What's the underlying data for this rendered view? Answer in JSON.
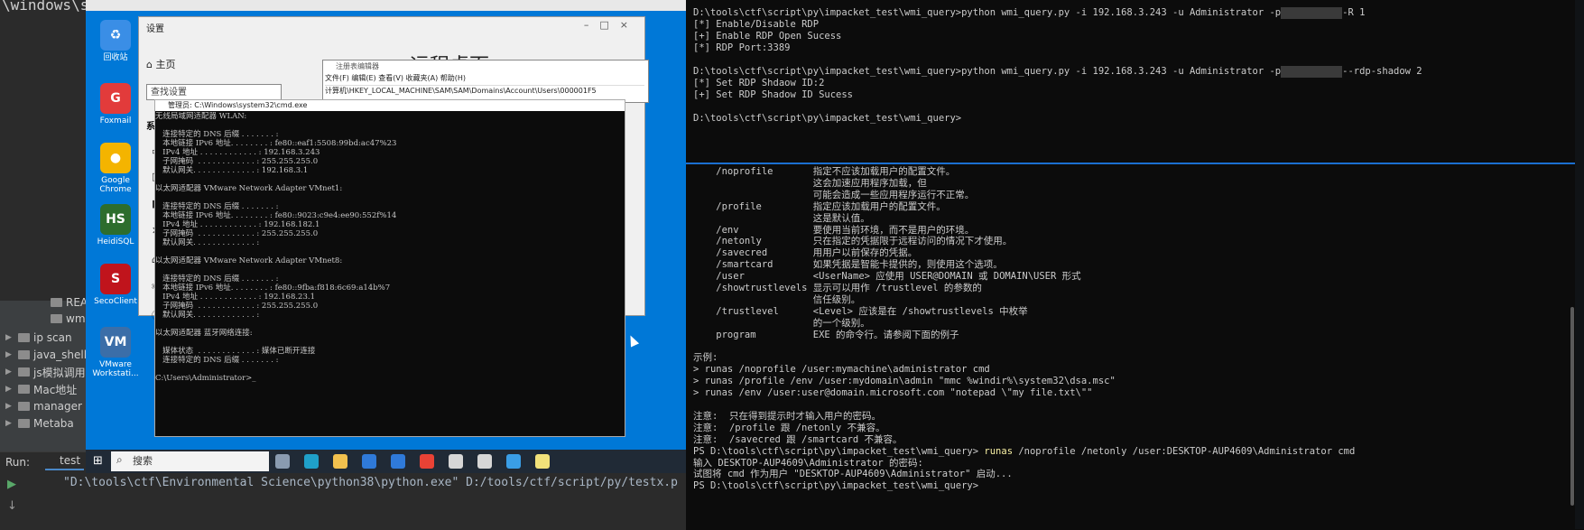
{
  "ide": {
    "top_text": "\\windows\\sys",
    "tree": [
      {
        "label": "REA",
        "icon": "file-icon"
      },
      {
        "label": "wm",
        "icon": "python-file-icon"
      },
      {
        "label": "ip scan",
        "icon": "folder-icon"
      },
      {
        "label": "java_shell",
        "icon": "folder-icon"
      },
      {
        "label": "js模拟调用",
        "icon": "folder-icon"
      },
      {
        "label": "Mac地址",
        "icon": "folder-icon"
      },
      {
        "label": "manager",
        "icon": "folder-icon"
      },
      {
        "label": "Metaba",
        "icon": "folder-icon"
      }
    ],
    "run_label": "Run:",
    "run_tab": "test",
    "run_cmd": "\"D:\\tools\\ctf\\Environmental Science\\python38\\python.exe\" D:/tools/ctf/script/py/testx.p"
  },
  "rdp": {
    "desktop_icons": [
      {
        "label": "回收站",
        "color": "#3a8ee6",
        "glyph": "♻"
      },
      {
        "label": "Foxmail",
        "color": "#e23b3b",
        "glyph": "G"
      },
      {
        "label": "Google Chrome",
        "color": "#f4b400",
        "glyph": "●"
      },
      {
        "label": "HeidiSQL",
        "color": "#2d6d2d",
        "glyph": "HS"
      },
      {
        "label": "SecoClient",
        "color": "#c0141c",
        "glyph": "S"
      },
      {
        "label": "VMware Workstati...",
        "color": "#3b6ea8",
        "glyph": "VM"
      }
    ],
    "settings": {
      "title": "设置",
      "home": "主页",
      "search_placeholder": "查找设置",
      "system": "系统",
      "remote_heading": "远程桌面"
    },
    "regedit": {
      "title": "注册表编辑器",
      "menu": "文件(F)  编辑(E)  查看(V)  收藏夹(A)  帮助(H)",
      "path": "计算机\\HKEY_LOCAL_MACHINE\\SAM\\SAM\\Domains\\Account\\Users\\000001F5"
    },
    "cmd": {
      "title": "管理员: C:\\Windows\\system32\\cmd.exe",
      "lines": [
        "无线局域网适配器 WLAN:",
        "",
        "   连接特定的 DNS 后缀 . . . . . . . :",
        "   本地链接 IPv6 地址. . . . . . . . : fe80::eaf1:5508:99bd:ac47%23",
        "   IPv4 地址 . . . . . . . . . . . . : 192.168.3.243",
        "   子网掩码  . . . . . . . . . . . . : 255.255.255.0",
        "   默认网关. . . . . . . . . . . . . : 192.168.3.1",
        "",
        "以太网适配器 VMware Network Adapter VMnet1:",
        "",
        "   连接特定的 DNS 后缀 . . . . . . . :",
        "   本地链接 IPv6 地址. . . . . . . . : fe80::9023:c9e4:ee90:552f%14",
        "   IPv4 地址 . . . . . . . . . . . . : 192.168.182.1",
        "   子网掩码  . . . . . . . . . . . . : 255.255.255.0",
        "   默认网关. . . . . . . . . . . . . :",
        "",
        "以太网适配器 VMware Network Adapter VMnet8:",
        "",
        "   连接特定的 DNS 后缀 . . . . . . . :",
        "   本地链接 IPv6 地址. . . . . . . . : fe80::9fba:f818:6c69:a14b%7",
        "   IPv4 地址 . . . . . . . . . . . . : 192.168.23.1",
        "   子网掩码  . . . . . . . . . . . . : 255.255.255.0",
        "   默认网关. . . . . . . . . . . . . :",
        "",
        "以太网适配器 蓝牙网络连接:",
        "",
        "   媒体状态  . . . . . . . . . . . . : 媒体已断开连接",
        "   连接特定的 DNS 后缀 . . . . . . . :",
        "",
        "C:\\Users\\Administrator>_"
      ]
    },
    "taskbar": {
      "search": "搜索",
      "apps": [
        {
          "name": "task-view-icon",
          "color": "#8a9bb0"
        },
        {
          "name": "edge-icon",
          "color": "#1fa0c9"
        },
        {
          "name": "explorer-icon",
          "color": "#f2c14e"
        },
        {
          "name": "store-icon",
          "color": "#2f7ad9"
        },
        {
          "name": "mail-icon",
          "color": "#2f7ad9"
        },
        {
          "name": "chrome-icon",
          "color": "#e94235"
        },
        {
          "name": "settings-icon",
          "color": "#d6d6d6"
        },
        {
          "name": "cmd-icon",
          "color": "#d6d6d6"
        },
        {
          "name": "vscode-icon",
          "color": "#3a9ee6"
        },
        {
          "name": "notepad-icon",
          "color": "#f2e27a"
        }
      ]
    }
  },
  "terminal_top": [
    {
      "pre": "D:\\tools\\ctf\\script\\py\\impacket_test\\wmi_query>python wmi_query.py -i 192.168.3.243 -u Administrator -p",
      "redacted": true,
      "post": "-R 1"
    },
    {
      "pre": "[*] Enable/Disable RDP"
    },
    {
      "pre": "[+] Enable RDP Open Sucess"
    },
    {
      "pre": "[*] RDP Port:3389"
    },
    {
      "pre": ""
    },
    {
      "pre": "D:\\tools\\ctf\\script\\py\\impacket_test\\wmi_query>python wmi_query.py -i 192.168.3.243 -u Administrator -p",
      "redacted": true,
      "post": "--rdp-shadow 2"
    },
    {
      "pre": "[*] Set RDP Shdaow ID:2"
    },
    {
      "pre": "[+] Set RDP Shadow ID Sucess"
    },
    {
      "pre": ""
    },
    {
      "pre": "D:\\tools\\ctf\\script\\py\\impacket_test\\wmi_query>"
    }
  ],
  "terminal_bottom": [
    {
      "text": "    /noprofile       指定不应该加载用户的配置文件。"
    },
    {
      "text": "                     这会加速应用程序加载，但"
    },
    {
      "text": "                     可能会造成一些应用程序运行不正常。"
    },
    {
      "text": "    /profile         指定应该加载用户的配置文件。"
    },
    {
      "text": "                     这是默认值。"
    },
    {
      "text": "    /env             要使用当前环境，而不是用户的环境。"
    },
    {
      "text": "    /netonly         只在指定的凭据限于远程访问的情况下才使用。"
    },
    {
      "text": "    /savecred        用用户以前保存的凭据。"
    },
    {
      "text": "    /smartcard       如果凭据是智能卡提供的，则使用这个选项。"
    },
    {
      "text": "    /user            <UserName> 应使用 USER@DOMAIN 或 DOMAIN\\USER 形式"
    },
    {
      "text": "    /showtrustlevels 显示可以用作 /trustlevel 的参数的"
    },
    {
      "text": "                     信任级别。"
    },
    {
      "text": "    /trustlevel      <Level> 应该是在 /showtrustlevels 中枚举"
    },
    {
      "text": "                     的一个级别。"
    },
    {
      "text": "    program          EXE 的命令行。请参阅下面的例子"
    },
    {
      "text": ""
    },
    {
      "text": "示例:"
    },
    {
      "text": "> runas /noprofile /user:mymachine\\administrator cmd"
    },
    {
      "text": "> runas /profile /env /user:mydomain\\admin \"mmc %windir%\\system32\\dsa.msc\""
    },
    {
      "text": "> runas /env /user:user@domain.microsoft.com \"notepad \\\"my file.txt\\\"\""
    },
    {
      "text": ""
    },
    {
      "text": "注意:  只在得到提示时才输入用户的密码。"
    },
    {
      "text": "注意:  /profile 跟 /netonly 不兼容。"
    },
    {
      "text": "注意:  /savecred 跟 /smartcard 不兼容。"
    },
    {
      "text": "PS D:\\tools\\ctf\\script\\py\\impacket_test\\wmi_query> ",
      "cmd": "runas",
      "rest": " /noprofile /netonly /user:DESKTOP-AUP4609\\Administrator cmd"
    },
    {
      "text": "输入 DESKTOP-AUP4609\\Administrator 的密码:"
    },
    {
      "text": "试图将 cmd 作为用户 \"DESKTOP-AUP4609\\Administrator\" 启动..."
    },
    {
      "text": "PS D:\\tools\\ctf\\script\\py\\impacket_test\\wmi_query>"
    }
  ]
}
